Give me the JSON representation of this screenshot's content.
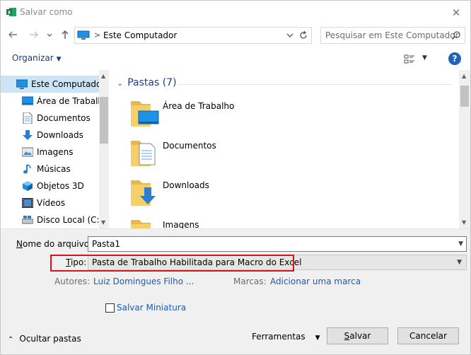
{
  "window": {
    "title": "Salvar como",
    "app_icon": "excel-icon"
  },
  "address": {
    "path_label": "Este Computador",
    "search_placeholder": "Pesquisar em Este Computador"
  },
  "toolbar": {
    "organize_label": "Organizar"
  },
  "nav_pane": {
    "items": [
      {
        "label": "Este Computador",
        "icon": "computer-icon",
        "selected": true
      },
      {
        "label": "Área de Trabalho",
        "icon": "desktop-icon"
      },
      {
        "label": "Documentos",
        "icon": "document-icon"
      },
      {
        "label": "Downloads",
        "icon": "download-icon"
      },
      {
        "label": "Imagens",
        "icon": "image-icon"
      },
      {
        "label": "Músicas",
        "icon": "music-icon"
      },
      {
        "label": "Objetos 3D",
        "icon": "cube-icon"
      },
      {
        "label": "Vídeos",
        "icon": "video-icon"
      },
      {
        "label": "Disco Local (C:)",
        "icon": "disk-icon"
      }
    ]
  },
  "content": {
    "group_title": "Pastas (7)",
    "folders": [
      {
        "label": "Área de Trabalho",
        "icon": "desktop-folder-icon"
      },
      {
        "label": "Documentos",
        "icon": "documents-folder-icon"
      },
      {
        "label": "Downloads",
        "icon": "downloads-folder-icon"
      },
      {
        "label": "Imagens",
        "icon": "images-folder-icon"
      }
    ]
  },
  "form": {
    "filename_label_first": "N",
    "filename_label_rest": "ome do arquivo:",
    "filename_value": "Pasta1",
    "type_label_first": "T",
    "type_label_rest": "ipo:",
    "type_value": "Pasta de Trabalho Habilitada para Macro do Excel",
    "authors_label": "Autores:",
    "authors_value": "Luiz Domingues Filho ...",
    "tags_label": "Marcas:",
    "tags_value": "Adicionar uma marca",
    "thumbnail_label": "Salvar Miniatura",
    "thumbnail_checked": false,
    "highlight_color": "#d9121b"
  },
  "footer": {
    "hide_folders_label": "Ocultar pastas",
    "tools_label": "Ferramentas",
    "save_label_first": "S",
    "save_label_rest": "alvar",
    "cancel_label": "Cancelar"
  }
}
